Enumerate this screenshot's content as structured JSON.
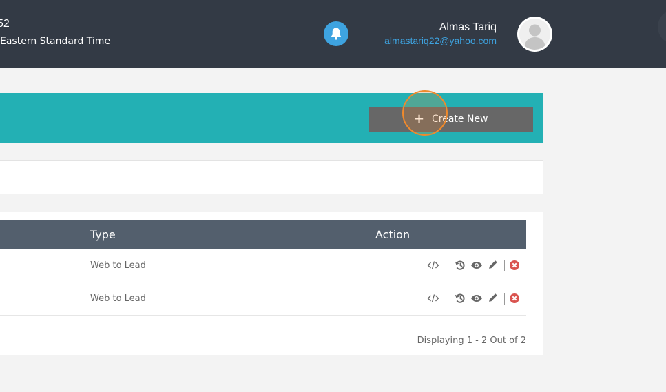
{
  "header": {
    "clock_time": "52",
    "clock_timezone": "Eastern Standard Time",
    "notifications_icon": "bell-icon",
    "user": {
      "name": "Almas Tariq",
      "email": "almastariq22@yahoo.com",
      "avatar_icon": "user-silhouette-icon"
    }
  },
  "toolbar": {
    "create_button": {
      "icon": "plus-icon",
      "label": "Create New"
    }
  },
  "table": {
    "columns": [
      "Type",
      "Action"
    ],
    "rows": [
      {
        "type": "Web to Lead",
        "actions": [
          "code-icon",
          "history-icon",
          "eye-icon",
          "pencil-icon",
          "delete-icon"
        ]
      },
      {
        "type": "Web to Lead",
        "actions": [
          "code-icon",
          "history-icon",
          "eye-icon",
          "pencil-icon",
          "delete-icon"
        ]
      }
    ],
    "pagination_text": "Displaying 1 - 2 Out of 2"
  },
  "colors": {
    "topbar": "#333a45",
    "accent_teal": "#23b0b4",
    "header_row": "#535f6d",
    "link_blue": "#3ea3e0",
    "delete_red": "#d9534f",
    "button_gray": "#676767"
  }
}
